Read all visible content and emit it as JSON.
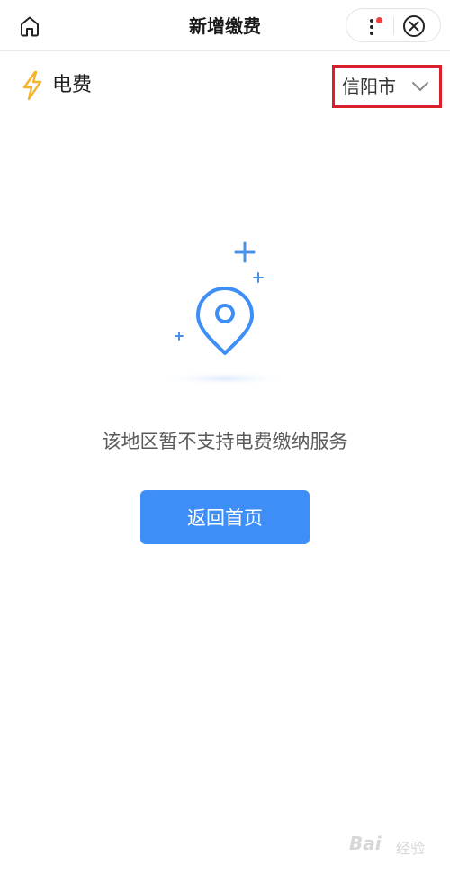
{
  "header": {
    "title": "新增缴费",
    "home_icon": "home-icon",
    "more_icon": "more-vertical-icon",
    "close_icon": "close-circle-icon",
    "notification_dot_color": "#f04141"
  },
  "bill": {
    "type_label": "电费",
    "type_icon": "lightning-bolt-icon",
    "icon_color": "#f3b32b",
    "city": "信阳市",
    "city_highlight_color": "#d9202a"
  },
  "empty_state": {
    "icon": "location-pin-icon",
    "message": "该地区暂不支持电费缴纳服务",
    "button_label": "返回首页",
    "accent_color": "#3d8ef7"
  },
  "watermark": {
    "text_a": "Bai",
    "text_b": "经验"
  }
}
